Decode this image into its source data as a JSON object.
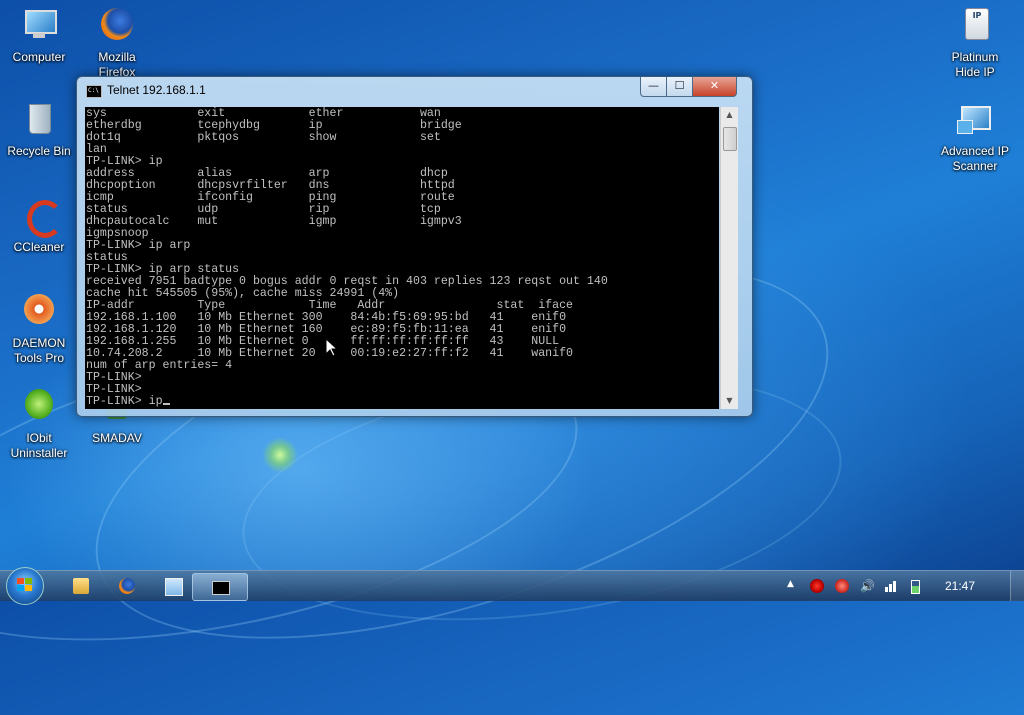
{
  "desktop": {
    "icons_left": [
      {
        "label": "Computer"
      },
      {
        "label": "Mozilla\nFirefox"
      },
      {
        "label": "Recycle Bin"
      },
      {
        "label": "CCleaner"
      },
      {
        "label": "DAEMON\nTools Pro"
      },
      {
        "label": "IObit\nUninstaller"
      },
      {
        "label": "SMADAV"
      }
    ],
    "icons_right": [
      {
        "label": "Platinum\nHide IP"
      },
      {
        "label": "Advanced IP\nScanner"
      }
    ]
  },
  "window": {
    "title": "Telnet 192.168.1.1",
    "icon_text": "C:\\",
    "minimize": "—",
    "maximize": "☐",
    "close": "✕"
  },
  "console": {
    "lines": [
      "sys             exit            ether           wan",
      "etherdbg        tcephydbg       ip              bridge",
      "dot1q           pktqos          show            set",
      "lan",
      "TP-LINK> ip",
      "address         alias           arp             dhcp",
      "dhcpoption      dhcpsvrfilter   dns             httpd",
      "icmp            ifconfig        ping            route",
      "status          udp             rip             tcp",
      "dhcpautocalc    mut             igmp            igmpv3",
      "igmpsnoop",
      "TP-LINK> ip arp",
      "status",
      "TP-LINK> ip arp status",
      "received 7951 badtype 0 bogus addr 0 reqst in 403 replies 123 reqst out 140",
      "cache hit 545505 (95%), cache miss 24991 (4%)",
      "IP-addr         Type            Time   Addr                stat  iface",
      "192.168.1.100   10 Mb Ethernet 300    84:4b:f5:69:95:bd   41    enif0",
      "192.168.1.120   10 Mb Ethernet 160    ec:89:f5:fb:11:ea   41    enif0",
      "192.168.1.255   10 Mb Ethernet 0      ff:ff:ff:ff:ff:ff   43    NULL",
      "10.74.208.2     10 Mb Ethernet 20     00:19:e2:27:ff:f2   41    wanif0",
      "num of arp entries= 4",
      "TP-LINK>",
      "TP-LINK>"
    ],
    "prompt": "TP-LINK> ip"
  },
  "taskbar": {
    "clock": "21:47",
    "tray_arrow": "▲"
  }
}
